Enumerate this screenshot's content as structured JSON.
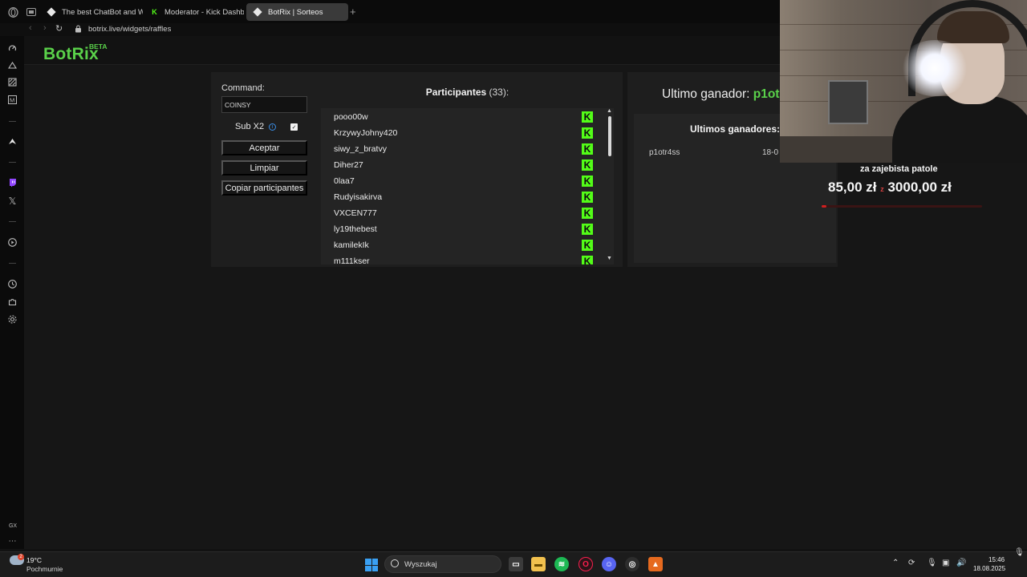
{
  "browser": {
    "tabs": [
      {
        "title": "The best ChatBot and Wi",
        "favicon": "botrix-icon",
        "active": false
      },
      {
        "title": "Moderator - Kick Dashbo",
        "favicon": "kick-icon",
        "active": false
      },
      {
        "title": "BotRix | Sorteos",
        "favicon": "botrix-icon",
        "active": true
      }
    ],
    "url": "botrix.live/widgets/raffles"
  },
  "site": {
    "logo": "BotRix",
    "badge": "BETA"
  },
  "raffle": {
    "command_label": "Command:",
    "command_value": "COINSY",
    "sub_label": "Sub X2",
    "sub_checked": true,
    "accept_label": "Aceptar",
    "clear_label": "Limpiar",
    "copy_label": "Copiar participantes",
    "participants_title": "Participantes",
    "participants_count": "(33):",
    "participants": [
      "pooo00w",
      "KrzywyJohny420",
      "siwy_z_bratvy",
      "Diher27",
      "0laa7",
      "Rudyisakirva",
      "VXCEN777",
      "ly19thebest",
      "kamilekIk",
      "m111kser"
    ],
    "platform_letter": "K",
    "platform_color": "#53fc18"
  },
  "winners": {
    "last_label": "Ultimo ganador:",
    "last_name": "p1ot",
    "list_title": "Ultimos ganadores:",
    "entries": [
      {
        "name": "p1otr4ss",
        "date": "18-0"
      }
    ]
  },
  "overlay": {
    "goal_title": "za zajebista patole",
    "current": "85,00 zł",
    "separator": "z",
    "target": "3000,00 zł",
    "progress_fraction": 0.028
  },
  "taskbar": {
    "temperature": "19°C",
    "weather": "Pochmurnie",
    "search_placeholder": "Wyszukaj",
    "time": "15:46",
    "date": "18.08.2025",
    "rail_bottom_label": "GX"
  }
}
